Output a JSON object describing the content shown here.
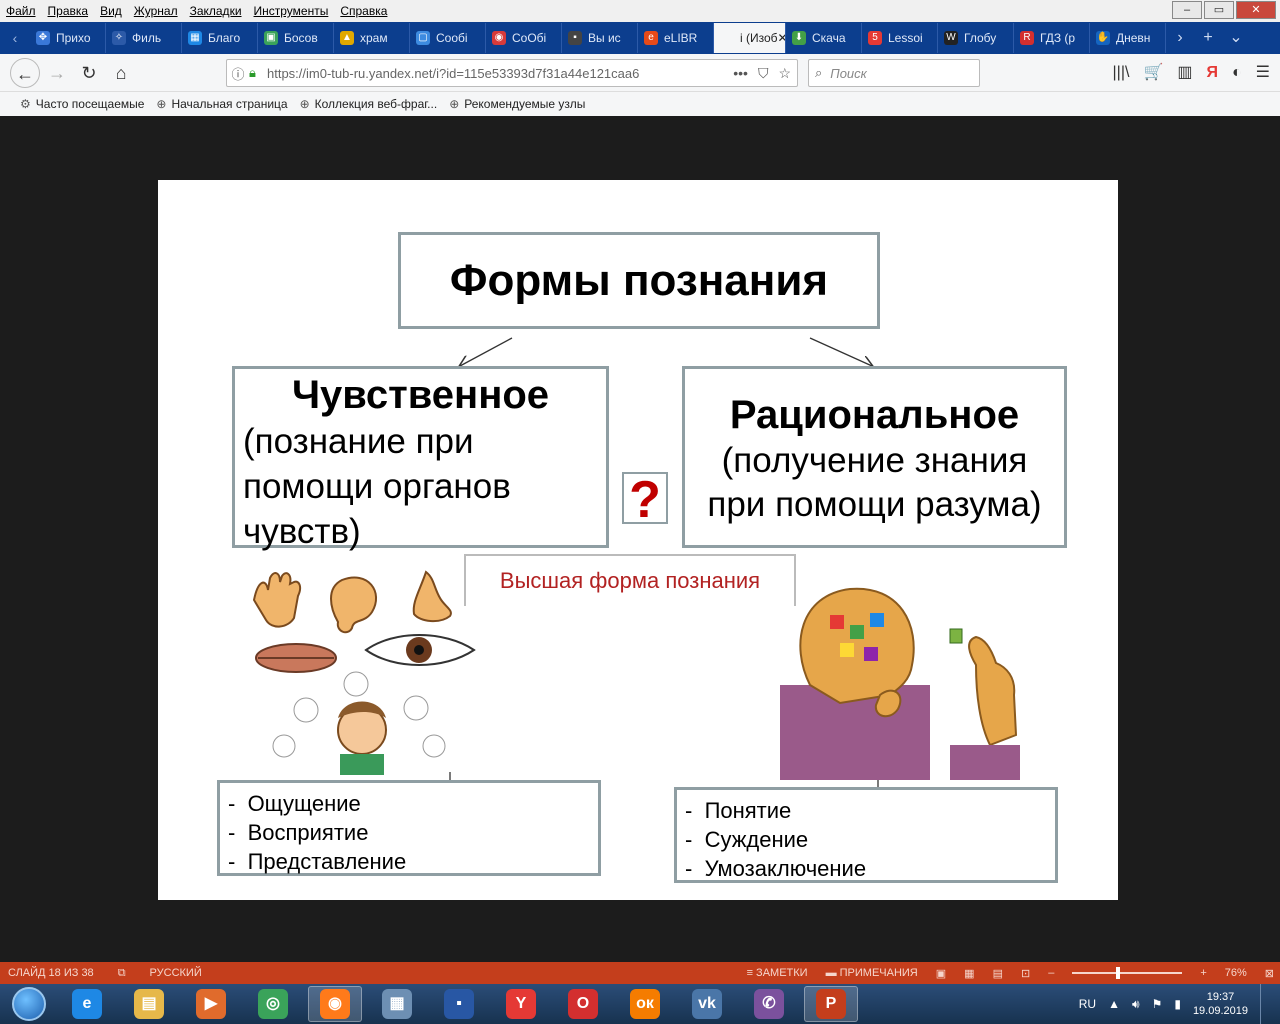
{
  "menubar": {
    "items": [
      "Файл",
      "Правка",
      "Вид",
      "Журнал",
      "Закладки",
      "Инструменты",
      "Справка"
    ],
    "window_controls": [
      "–",
      "▭",
      "✕"
    ]
  },
  "tabs": [
    {
      "label": "Прихо",
      "color": "#3a78d8",
      "glyph": "✥"
    },
    {
      "label": "Филь",
      "color": "#2c5aa8",
      "glyph": "✧"
    },
    {
      "label": "Благо",
      "color": "#1e88e5",
      "glyph": "▦"
    },
    {
      "label": "Босов",
      "color": "#3aa35a",
      "glyph": "▣"
    },
    {
      "label": "храм",
      "color": "#e0a800",
      "glyph": "▲"
    },
    {
      "label": "Сообі",
      "color": "#3d8be0",
      "glyph": "▢"
    },
    {
      "label": "СоОбі",
      "color": "#d83a3a",
      "glyph": "◉"
    },
    {
      "label": "Вы ис",
      "color": "#444",
      "glyph": "▪"
    },
    {
      "label": "eLIBR",
      "color": "#e64a19",
      "glyph": "e"
    },
    {
      "label": "i (Изоб",
      "color": "#ffffff",
      "glyph": "",
      "active": true
    },
    {
      "label": "Скача",
      "color": "#43a047",
      "glyph": "⬇"
    },
    {
      "label": "Lessoі",
      "color": "#e53935",
      "glyph": "5"
    },
    {
      "label": "Глобу",
      "color": "#222",
      "glyph": "W"
    },
    {
      "label": "ГДЗ (р",
      "color": "#d32f2f",
      "glyph": "R"
    },
    {
      "label": "Дневн",
      "color": "#1565c0",
      "glyph": "✋"
    }
  ],
  "navbar": {
    "url": "https://im0-tub-ru.yandex.net/i?id=115e53393d7f31a44e121caa6",
    "url_domain": "yandex.net",
    "search_placeholder": "Поиск",
    "url_actions": [
      "•••",
      "⛉",
      "☆"
    ],
    "right_icons": [
      "|||\\",
      "🛒",
      "▥",
      "Я",
      "◐",
      "☰"
    ]
  },
  "bookmarks": [
    {
      "label": "Часто посещаемые",
      "icon": "gear-icon"
    },
    {
      "label": "Начальная страница",
      "icon": "globe-icon"
    },
    {
      "label": "Коллекция веб-фраг...",
      "icon": "globe-icon"
    },
    {
      "label": "Рекомендуемые узлы",
      "icon": "globe-icon"
    }
  ],
  "slide": {
    "title": "Формы познания",
    "left": {
      "heading": "Чувственное",
      "description": "(познание при помощи органов чувств)"
    },
    "right": {
      "heading": "Рациональное",
      "description": "(получение знания при помощи разума)"
    },
    "question": "?",
    "highest_form": "Высшая форма познания",
    "left_list": [
      "Ощущение",
      "Восприятие",
      "Представление"
    ],
    "right_list": [
      "Понятие",
      "Суждение",
      "Умозаключение"
    ],
    "colors": {
      "border": "#8f9ea3",
      "question": "#c00000",
      "highest": "#b22222"
    }
  },
  "app_status": {
    "slide_info": "СЛАЙД 18 ИЗ 38",
    "language": "РУССКИЙ",
    "notes": "ЗАМЕТКИ",
    "comments": "ПРИМЕЧАНИЯ",
    "zoom": "76%"
  },
  "taskbar": {
    "apps": [
      {
        "name": "internet-explorer",
        "glyph": "e",
        "color": "#1e88e5"
      },
      {
        "name": "file-explorer",
        "glyph": "▤",
        "color": "#e6b84a"
      },
      {
        "name": "media-player",
        "glyph": "▶",
        "color": "#e06b2c"
      },
      {
        "name": "chrome",
        "glyph": "◎",
        "color": "#3aa35a"
      },
      {
        "name": "firefox",
        "glyph": "◉",
        "color": "#ff7a1a"
      },
      {
        "name": "calculator",
        "glyph": "▦",
        "color": "#6d8fb3"
      },
      {
        "name": "save-disk",
        "glyph": "▪",
        "color": "#2857a4"
      },
      {
        "name": "yandex",
        "glyph": "Y",
        "color": "#e53935"
      },
      {
        "name": "opera",
        "glyph": "O",
        "color": "#d32f2f"
      },
      {
        "name": "odnoklassniki",
        "glyph": "ок",
        "color": "#f57c00"
      },
      {
        "name": "vkontakte",
        "glyph": "vk",
        "color": "#4a76a8"
      },
      {
        "name": "viber",
        "glyph": "✆",
        "color": "#7b519d"
      },
      {
        "name": "powerpoint",
        "glyph": "P",
        "color": "#c43e1c"
      }
    ],
    "lang": "RU",
    "time": "19:37",
    "date": "19.09.2019"
  }
}
